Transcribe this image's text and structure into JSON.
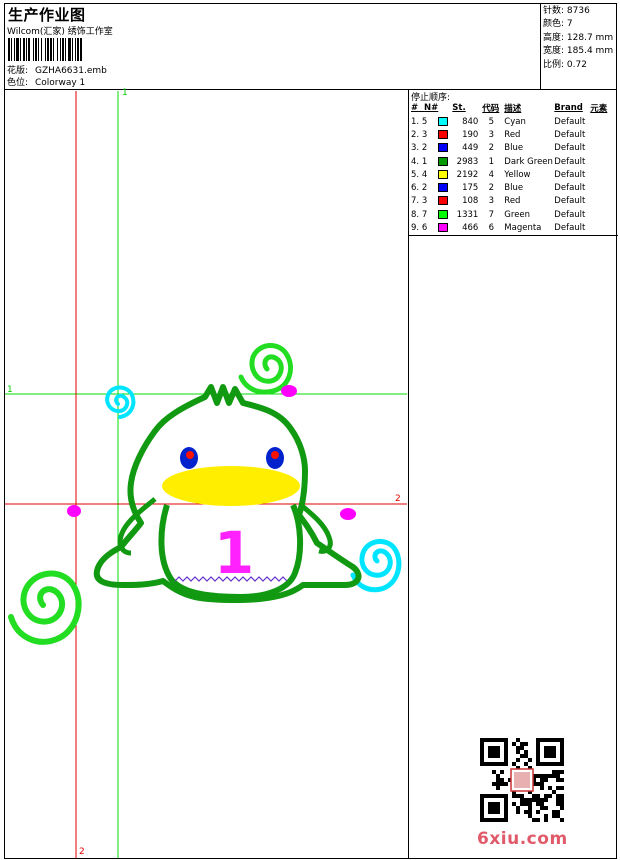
{
  "header": {
    "title": "生产作业图",
    "studio": "Wilcom(汇家) 绣饰工作室",
    "pattern_label": "花版:",
    "pattern_value": "GZHA6631.emb",
    "colorway_label": "色位:",
    "colorway_value": "Colorway 1"
  },
  "stats": [
    {
      "label": "针数:",
      "value": "8736"
    },
    {
      "label": "颜色:",
      "value": "7"
    },
    {
      "label": "高度:",
      "value": "128.7 mm"
    },
    {
      "label": "宽度:",
      "value": "185.4 mm"
    },
    {
      "label": "比例:",
      "value": "0.72"
    }
  ],
  "sequence": {
    "title": "停止顺序:",
    "headers": {
      "idx": "#",
      "no": "N#",
      "st": "St.",
      "code": "代码",
      "desc": "描述",
      "brand": "Brand",
      "element": "元素"
    },
    "rows": [
      {
        "idx": "1.",
        "no": "5",
        "color": "#00ffff",
        "st": "840",
        "code": "5",
        "desc": "Cyan",
        "brand": "Default"
      },
      {
        "idx": "2.",
        "no": "3",
        "color": "#ff0000",
        "st": "190",
        "code": "3",
        "desc": "Red",
        "brand": "Default"
      },
      {
        "idx": "3.",
        "no": "2",
        "color": "#0000ff",
        "st": "449",
        "code": "2",
        "desc": "Blue",
        "brand": "Default"
      },
      {
        "idx": "4.",
        "no": "1",
        "color": "#009900",
        "st": "2983",
        "code": "1",
        "desc": "Dark Green",
        "brand": "Default"
      },
      {
        "idx": "5.",
        "no": "4",
        "color": "#ffff00",
        "st": "2192",
        "code": "4",
        "desc": "Yellow",
        "brand": "Default"
      },
      {
        "idx": "6.",
        "no": "2",
        "color": "#0000ff",
        "st": "175",
        "code": "2",
        "desc": "Blue",
        "brand": "Default"
      },
      {
        "idx": "7.",
        "no": "3",
        "color": "#ff0000",
        "st": "108",
        "code": "3",
        "desc": "Red",
        "brand": "Default"
      },
      {
        "idx": "8.",
        "no": "7",
        "color": "#00ff00",
        "st": "1331",
        "code": "7",
        "desc": "Green",
        "brand": "Default"
      },
      {
        "idx": "9.",
        "no": "6",
        "color": "#ff00ff",
        "st": "466",
        "code": "6",
        "desc": "Magenta",
        "brand": "Default"
      }
    ]
  },
  "design": {
    "number_glyph": "1",
    "guide_labels": {
      "green_top": "1",
      "green_left": "1",
      "red_right": "2",
      "red_bottom": "2"
    },
    "guide_colors": {
      "green": "#00dd00",
      "red": "#e00000"
    }
  },
  "footer": {
    "watermark": "6xiu.com",
    "qr_icon": "qr-code-icon"
  }
}
